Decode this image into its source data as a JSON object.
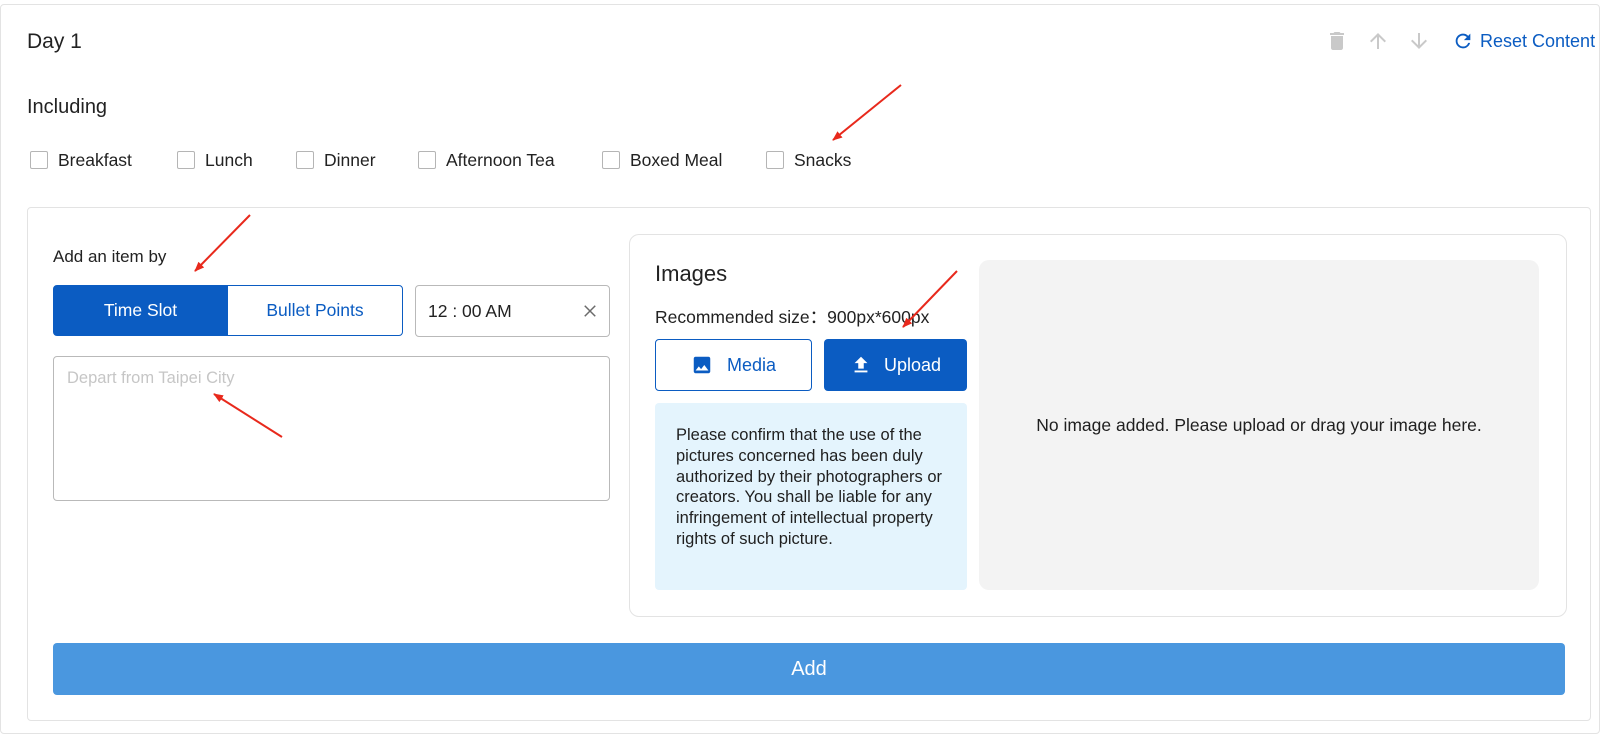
{
  "day": {
    "title": "Day 1"
  },
  "toolbar": {
    "delete_icon": "delete-icon",
    "move_up_icon": "arrow-up-icon",
    "move_down_icon": "arrow-down-icon",
    "reset_icon": "refresh-icon",
    "reset_label": "Reset Content"
  },
  "including": {
    "label": "Including",
    "options": [
      {
        "label": "Breakfast",
        "checked": false
      },
      {
        "label": "Lunch",
        "checked": false
      },
      {
        "label": "Dinner",
        "checked": false
      },
      {
        "label": "Afternoon Tea",
        "checked": false
      },
      {
        "label": "Boxed Meal",
        "checked": false
      },
      {
        "label": "Snacks",
        "checked": false
      }
    ]
  },
  "item_form": {
    "add_by_label": "Add an item by",
    "modes": [
      {
        "label": "Time Slot",
        "active": true
      },
      {
        "label": "Bullet Points",
        "active": false
      }
    ],
    "time_value": "12 : 00 AM",
    "description_placeholder": "Depart from Taipei City"
  },
  "images": {
    "title": "Images",
    "recommended_size": "Recommended size：900px*600px",
    "media_label": "Media",
    "upload_label": "Upload",
    "notice": "Please confirm that the use of the pictures concerned has been duly authorized by their photographers or creators. You shall be liable for any infringement of intellectual property rights of such picture.",
    "empty_text": "No image added. Please upload or drag your image here."
  },
  "add_button": {
    "label": "Add"
  },
  "colors": {
    "primary": "#0b5cc2",
    "add_button": "#4a97df",
    "notice_bg": "#e4f4fd",
    "dropzone_bg": "#f3f3f3",
    "annotation_arrow": "#e8291c"
  }
}
